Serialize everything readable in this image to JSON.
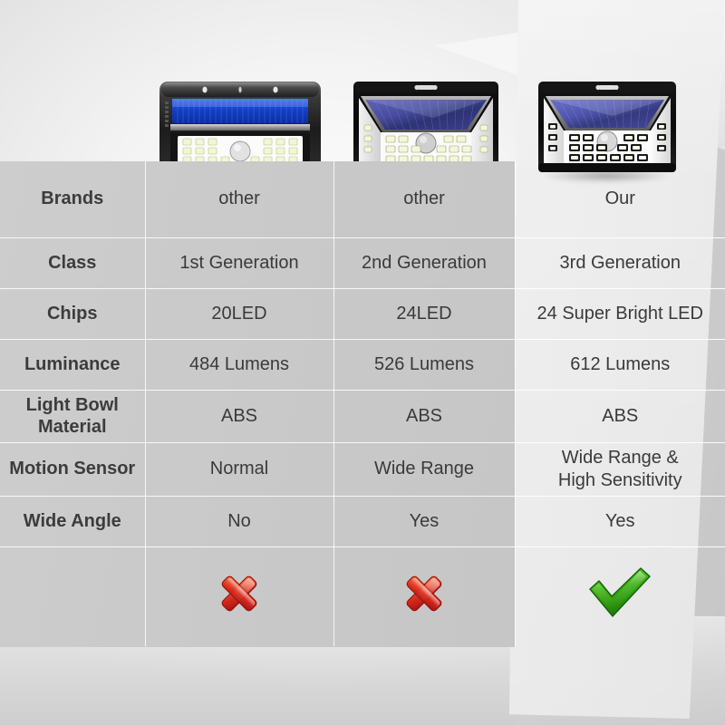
{
  "title": "Solar LED Wall Light Comparison Chart",
  "accent": {
    "bright_green": "#22cc22",
    "dark_green": "#2f8b31",
    "red_x": "#dd2a18",
    "label_gray": "#3c3c3c",
    "value_gray": "#3a3a3a"
  },
  "table": {
    "row_label_header": "",
    "columns": [
      {
        "key": "label",
        "header": ""
      },
      {
        "key": "other1",
        "header": "other",
        "highlight": false
      },
      {
        "key": "other2",
        "header": "other",
        "highlight": false
      },
      {
        "key": "our",
        "header": "Our",
        "highlight": true
      }
    ],
    "rows": [
      {
        "label": "Brands",
        "other1": "other",
        "other2": "other",
        "our": "Our"
      },
      {
        "label": "Class",
        "other1": "1st Generation",
        "other2": "2nd Generation",
        "our": "3rd Generation"
      },
      {
        "label": "Chips",
        "other1": "20LED",
        "other2": "24LED",
        "our": "24 Super Bright LED"
      },
      {
        "label": "Luminance",
        "other1": "484 Lumens",
        "other2": "526 Lumens",
        "our": "612 Lumens"
      },
      {
        "label_line1": "Light Bowl",
        "label_line2": "Material",
        "other1": "ABS",
        "other2": "ABS",
        "our": "ABS"
      },
      {
        "label_line1": "Motion",
        "label_line2": "Sensor",
        "other1": "Normal",
        "other2": "Wide Range",
        "our_line1": "Wide Range &",
        "our_line2": "High Sensitivity"
      },
      {
        "label_line1": "Wide",
        "label_line2": "Angle",
        "other1": "No",
        "other2": "Yes",
        "our": "Yes"
      }
    ],
    "verdict_row": {
      "label": "",
      "other1_icon": "red-x-icon",
      "other2_icon": "red-x-icon",
      "our_icon": "green-check-icon"
    }
  },
  "products": [
    {
      "name": "product-image-generation-1",
      "led_count": 18,
      "panel_color": "#1b52d8",
      "style": "flat-rectangular"
    },
    {
      "name": "product-image-generation-2",
      "led_count": 24,
      "panel_color": "#3b3f86",
      "style": "angled-wide-wings"
    },
    {
      "name": "product-image-generation-3",
      "led_count": 24,
      "panel_color": "#4248a0",
      "style": "angled-wide-wings-bright"
    }
  ]
}
